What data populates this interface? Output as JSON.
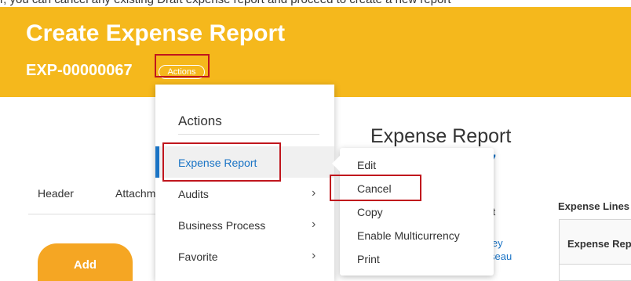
{
  "top_text": "r, you can cancel any existing Draft expense report and proceed to create a new report",
  "banner": {
    "title": "Create Expense Report",
    "report_id": "EXP-00000067",
    "actions_pill": "Actions"
  },
  "tabs": [
    "Header",
    "Attachments"
  ],
  "add_button": "Add",
  "report": {
    "title": "Expense Report",
    "number_fragment": "7",
    "status_fragment": "ft",
    "user_fragment_1": "ley",
    "user_fragment_2": "seau",
    "lines_label": "Expense Lines",
    "lines_header": "Expense Report"
  },
  "actions_menu": {
    "header": "Actions",
    "items": [
      {
        "label": "Expense Report",
        "selected": true,
        "submenu": true
      },
      {
        "label": "Audits",
        "selected": false,
        "submenu": true
      },
      {
        "label": "Business Process",
        "selected": false,
        "submenu": true
      },
      {
        "label": "Favorite",
        "selected": false,
        "submenu": true
      }
    ]
  },
  "submenu": {
    "items": [
      "Edit",
      "Cancel",
      "Copy",
      "Enable Multicurrency",
      "Print"
    ]
  },
  "colors": {
    "banner": "#f5b81c",
    "accent_blue": "#1b74c5",
    "highlight_red": "#c0161d",
    "add_button": "#f5a623"
  }
}
